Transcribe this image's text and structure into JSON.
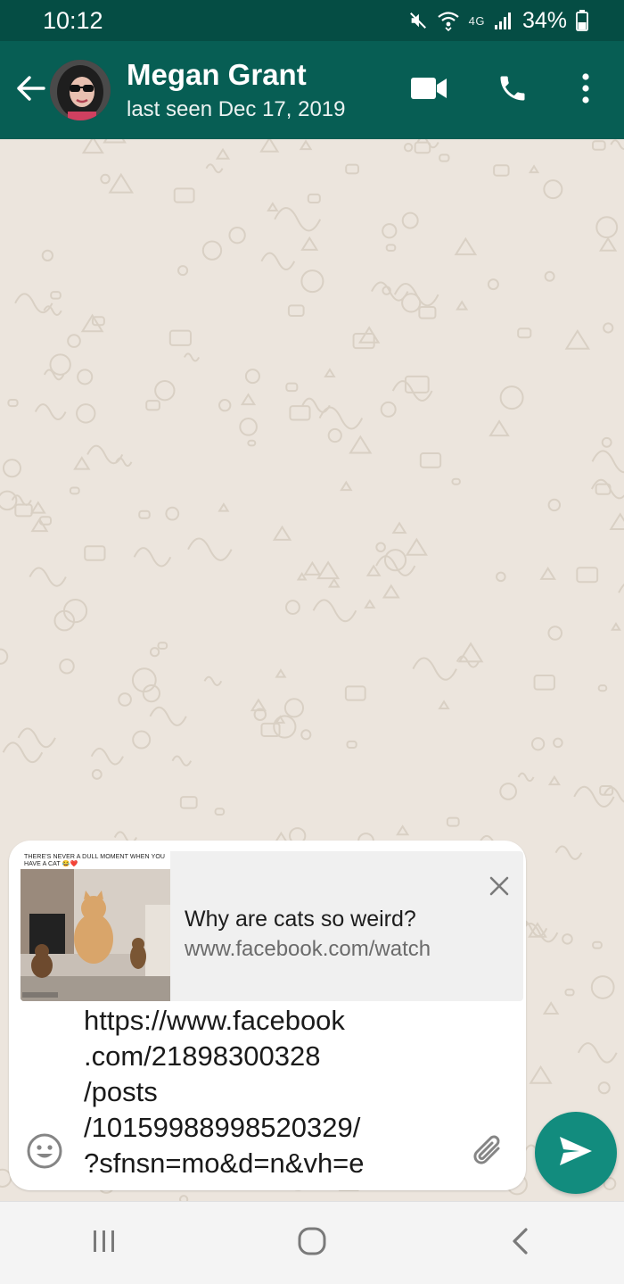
{
  "status_bar": {
    "time": "10:12",
    "network_label": "4G",
    "battery": "34%"
  },
  "header": {
    "contact_name": "Megan Grant",
    "last_seen": "last seen Dec 17, 2019",
    "icons": [
      "back-arrow-icon",
      "video-call-icon",
      "phone-icon",
      "more-vert-icon"
    ],
    "color": "#075e54"
  },
  "link_preview": {
    "thumbnail_caption": "THERE'S NEVER A DULL MOMENT WHEN YOU HAVE A CAT 😂❤️",
    "title": "Why are cats so weird?",
    "url": "www.facebook.com/watch"
  },
  "composer": {
    "message": "https://www.facebook\n.com/21898300328\n/posts\n/10159988998520329/\n?sfnsn=mo&d=n&vh=e"
  },
  "colors": {
    "status_bar": "#054d44",
    "send_button": "#128c7e",
    "wallpaper": "#ece5dd"
  }
}
